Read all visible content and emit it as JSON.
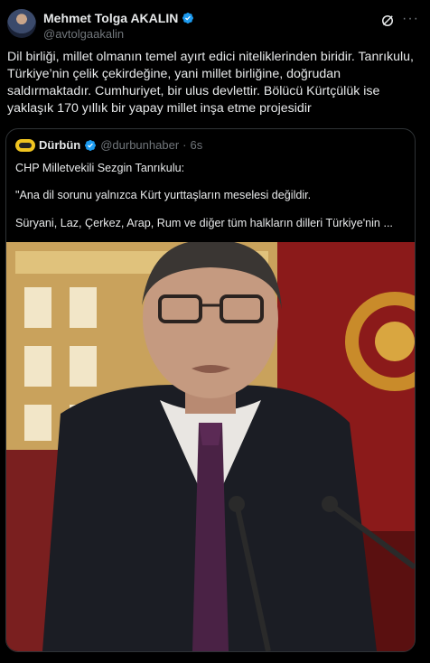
{
  "author": {
    "display_name": "Mehmet Tolga AKALIN",
    "handle": "@avtolgaakalin"
  },
  "tweet": {
    "lines": [
      "Dil birliği, millet olmanın temel ayırt edici niteliklerinden biridir. Tanrıkulu,",
      "Türkiye’nin çelik çekirdeğine, yani millet birliğine, doğrudan",
      "saldırmaktadır. Cumhuriyet, bir ulus devlettir. Bölücü Kürtçülük ise",
      "yaklaşık 170 yıllık  bir  yapay millet inşa etme projesidir"
    ]
  },
  "quote": {
    "name": "Dürbün",
    "handle": "@durbunhaber",
    "separator": "·",
    "time": "6s",
    "line1": "CHP Milletvekili Sezgin Tanrıkulu:",
    "line2": "\"Ana dil sorunu yalnızca Kürt yurttaşların meselesi değildir.",
    "line3": "Süryani, Laz, Çerkez, Arap, Rum ve diğer tüm halkların dilleri Türkiye'nin ..."
  },
  "colors": {
    "verified": "#1d9bf0",
    "text": "#e7e9ea",
    "muted": "#71767b"
  },
  "icons": [
    "verified-badge-icon",
    "grok-icon",
    "more-icon"
  ]
}
